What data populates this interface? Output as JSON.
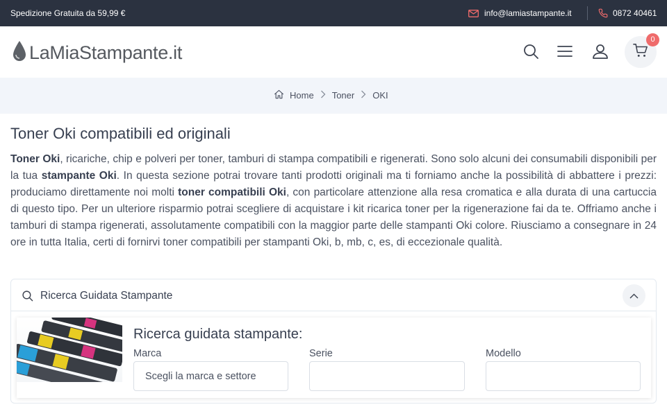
{
  "topbar": {
    "shipping": "Spedizione Gratuita da 59,99 €",
    "email": "info@lamiastampante.it",
    "phone": "0872 40461"
  },
  "header": {
    "logo_text": "LaMiaStampante.it",
    "cart_count": "0"
  },
  "breadcrumb": [
    "Home",
    "Toner",
    "OKI"
  ],
  "page": {
    "title": "Toner Oki compatibili ed originali",
    "intro": [
      {
        "b": "Toner Oki"
      },
      ", ricariche, chip e polveri per toner, tamburi di stampa compatibili e rigenerati. Sono solo alcuni dei consumabili disponibili per la tua ",
      {
        "b": "stampante Oki"
      },
      ". In questa sezione potrai trovare tanti prodotti originali ma ti forniamo anche la possibilità di abbattere i prezzi: produciamo direttamente noi molti ",
      {
        "b": "toner compatibili Oki"
      },
      ", con particolare attenzione alla resa cromatica e alla durata di una cartuccia di questo tipo. Per un ulteriore risparmio potrai scegliere di acquistare i kit ricarica toner per la rigenerazione fai da te. Offriamo anche i tamburi di stampa rigenerati, assolutamente compatibili con la maggior parte delle stampanti Oki colore. Riusciamo a consegnare in 24 ore in tutta Italia, certi di fornirvi toner compatibili per stampanti Oki, b, mb, c, es, di eccezionale qualità."
    ]
  },
  "search": {
    "panel_title": "Ricerca Guidata Stampante",
    "heading": "Ricerca guidata stampante:",
    "fields": [
      {
        "label": "Marca",
        "value": "Scegli la marca e settore"
      },
      {
        "label": "Serie",
        "value": ""
      },
      {
        "label": "Modello",
        "value": ""
      }
    ]
  },
  "colors": {
    "topbar_bg": "#2b3240",
    "accent": "#ef6b6b",
    "breadcrumb_bg": "#f2f5fa"
  },
  "icons": [
    "mail-icon",
    "phone-icon",
    "ink-drop-icon",
    "search-icon",
    "menu-icon",
    "user-icon",
    "cart-icon",
    "home-icon",
    "chevron-right-icon",
    "chevron-up-icon"
  ]
}
